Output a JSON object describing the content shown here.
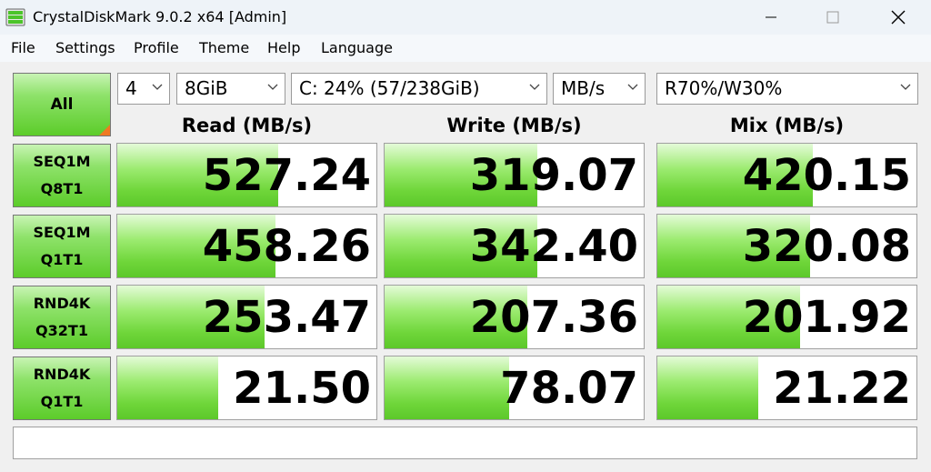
{
  "window": {
    "title": "CrystalDiskMark 9.0.2 x64 [Admin]"
  },
  "menu": [
    "File",
    "Settings",
    "Profile",
    "Theme",
    "Help",
    "Language"
  ],
  "controls": {
    "all_label": "All",
    "count": "4",
    "size": "8GiB",
    "drive": "C: 24% (57/238GiB)",
    "unit": "MB/s",
    "mix": "R70%/W30%"
  },
  "columns": {
    "read": "Read (MB/s)",
    "write": "Write (MB/s)",
    "mix": "Mix (MB/s)"
  },
  "rows": [
    {
      "label1": "SEQ1M",
      "label2": "Q8T1",
      "read": "527.24",
      "write": "319.07",
      "mix": "420.15",
      "read_fill": 0.62,
      "write_fill": 0.59,
      "mix_fill": 0.6
    },
    {
      "label1": "SEQ1M",
      "label2": "Q1T1",
      "read": "458.26",
      "write": "342.40",
      "mix": "320.08",
      "read_fill": 0.61,
      "write_fill": 0.59,
      "mix_fill": 0.59
    },
    {
      "label1": "RND4K",
      "label2": "Q32T1",
      "read": "253.47",
      "write": "207.36",
      "mix": "201.92",
      "read_fill": 0.57,
      "write_fill": 0.55,
      "mix_fill": 0.55
    },
    {
      "label1": "RND4K",
      "label2": "Q1T1",
      "read": "21.50",
      "write": "78.07",
      "mix": "21.22",
      "read_fill": 0.39,
      "write_fill": 0.48,
      "mix_fill": 0.39
    }
  ],
  "comment": "",
  "colors": {
    "accent_green": "#6fd63a",
    "corner_orange": "#f07a22"
  },
  "icons": [
    "crystaldiskmark-app-icon",
    "minimize-icon",
    "maximize-icon",
    "close-icon",
    "chevron-down-icon"
  ]
}
